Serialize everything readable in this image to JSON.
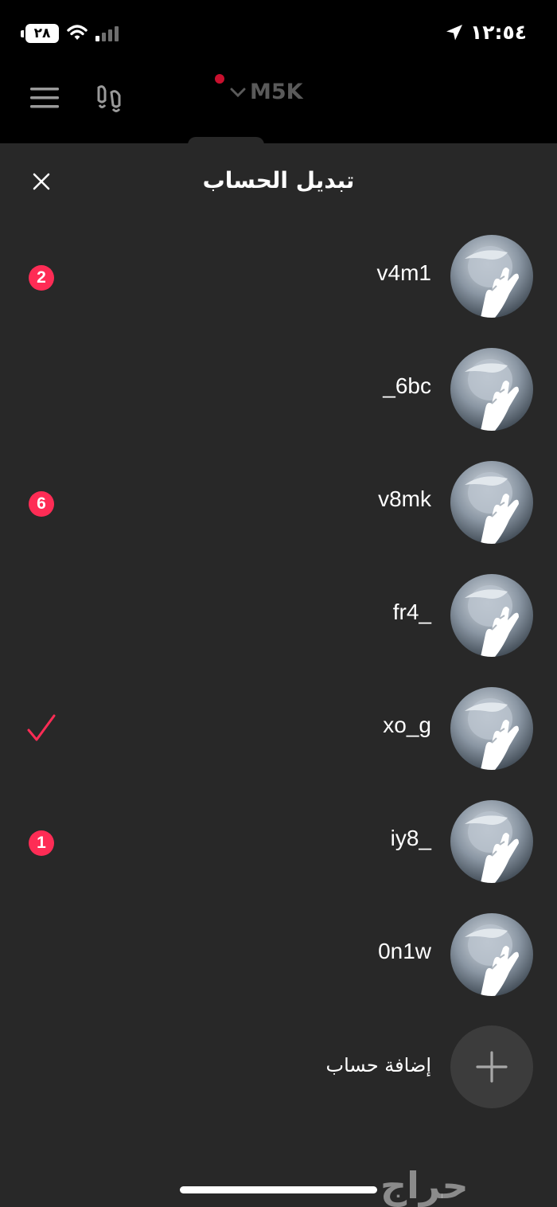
{
  "status_bar": {
    "time": "١٢:٥٤",
    "battery": "٢٨",
    "icons": [
      "location-arrow-icon",
      "signal-icon",
      "wifi-icon",
      "battery-icon"
    ]
  },
  "header": {
    "current_account": "M5K",
    "icons": [
      "menu-icon",
      "footprints-icon",
      "chevron-down-icon"
    ],
    "recording_dot_color": "#c8102e"
  },
  "sheet": {
    "title": "تبديل الحساب",
    "accounts": [
      {
        "username": "v4m1",
        "badge": "2",
        "selected": false
      },
      {
        "username": "_6bc",
        "badge": "",
        "selected": false
      },
      {
        "username": "v8mk",
        "badge": "6",
        "selected": false
      },
      {
        "username": "fr4_",
        "badge": "",
        "selected": false
      },
      {
        "username": "xo_g",
        "badge": "",
        "selected": true
      },
      {
        "username": "iy8_",
        "badge": "1",
        "selected": false
      },
      {
        "username": "0n1w",
        "badge": "",
        "selected": false
      }
    ],
    "add_account_label": "إضافة حساب"
  },
  "watermark": "حراج",
  "colors": {
    "accent": "#fe2c55",
    "sheet_background": "#282828",
    "background": "#000000"
  }
}
